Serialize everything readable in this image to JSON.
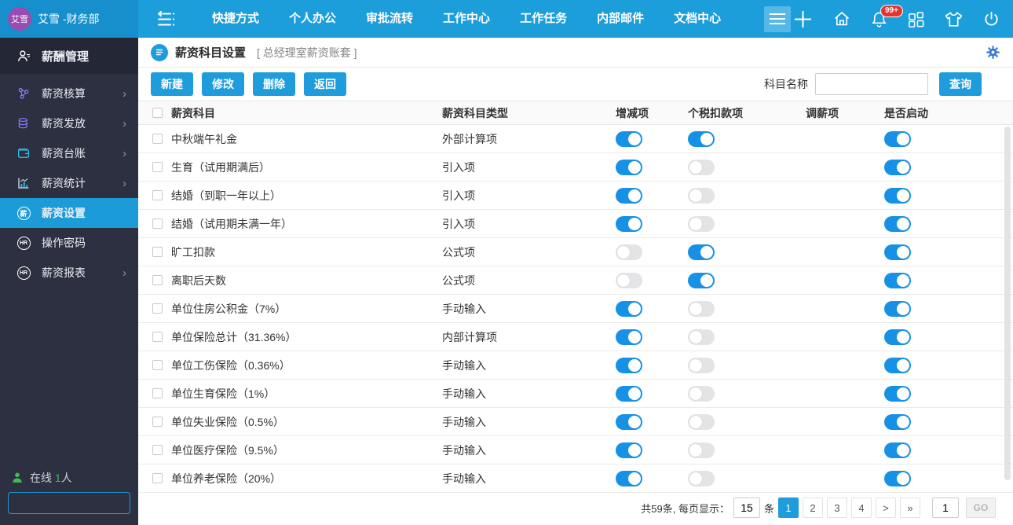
{
  "topbar": {
    "user": {
      "avatar_text": "艾雪",
      "name": "艾雪 -财务部"
    },
    "nav_items": [
      "快捷方式",
      "个人办公",
      "审批流转",
      "工作中心",
      "工作任务",
      "内部邮件",
      "文档中心"
    ],
    "notification_badge": "99+"
  },
  "sidebar": {
    "items": [
      {
        "label": "薪酬管理",
        "icon": "user-icon",
        "style": "header",
        "arrow": false,
        "active": false
      },
      {
        "label": "薪资核算",
        "icon": "nodes-icon",
        "style": "item",
        "arrow": true,
        "active": false
      },
      {
        "label": "薪资发放",
        "icon": "coins-icon",
        "style": "item",
        "arrow": true,
        "active": false
      },
      {
        "label": "薪资台账",
        "icon": "wallet-icon",
        "style": "item",
        "arrow": true,
        "active": false
      },
      {
        "label": "薪资统计",
        "icon": "chart-icon",
        "style": "item",
        "arrow": true,
        "active": false
      },
      {
        "label": "薪资设置",
        "icon": "salary-circle-icon",
        "style": "item",
        "arrow": false,
        "active": true
      },
      {
        "label": "操作密码",
        "icon": "hr-circle-icon",
        "style": "item",
        "arrow": false,
        "active": false
      },
      {
        "label": "薪资报表",
        "icon": "hr-circle-icon",
        "style": "item",
        "arrow": true,
        "active": false
      }
    ],
    "online": {
      "prefix": "在线",
      "count": "1",
      "suffix": "人"
    },
    "search_value": ""
  },
  "page": {
    "title": "薪资科目设置",
    "subtitle": "[ 总经理室薪资账套 ]",
    "toolbar": {
      "buttons": [
        {
          "label": "新建",
          "name": "new-button"
        },
        {
          "label": "修改",
          "name": "edit-button"
        },
        {
          "label": "删除",
          "name": "delete-button"
        },
        {
          "label": "返回",
          "name": "back-button"
        }
      ],
      "filter_label": "科目名称",
      "filter_value": "",
      "search_button": "查询"
    },
    "table": {
      "columns": [
        "薪资科目",
        "薪资科目类型",
        "增减项",
        "个税扣款项",
        "调薪项",
        "是否启动"
      ],
      "rows": [
        {
          "name": "中秋端午礼金",
          "type": "外部计算项",
          "inc": "on",
          "tax": "on",
          "adjust": "",
          "enabled": "on"
        },
        {
          "name": "生育（试用期满后）",
          "type": "引入项",
          "inc": "on",
          "tax": "off",
          "adjust": "",
          "enabled": "on"
        },
        {
          "name": "结婚（到职一年以上）",
          "type": "引入项",
          "inc": "on",
          "tax": "off",
          "adjust": "",
          "enabled": "on"
        },
        {
          "name": "结婚（试用期未满一年）",
          "type": "引入项",
          "inc": "on",
          "tax": "off",
          "adjust": "",
          "enabled": "on"
        },
        {
          "name": "旷工扣款",
          "type": "公式项",
          "inc": "off",
          "tax": "on",
          "adjust": "",
          "enabled": "on"
        },
        {
          "name": "离职后天数",
          "type": "公式项",
          "inc": "off",
          "tax": "on",
          "adjust": "",
          "enabled": "on"
        },
        {
          "name": "单位住房公积金（7%）",
          "type": "手动输入",
          "inc": "on",
          "tax": "off",
          "adjust": "",
          "enabled": "on"
        },
        {
          "name": "单位保险总计（31.36%）",
          "type": "内部计算项",
          "inc": "on",
          "tax": "off",
          "adjust": "",
          "enabled": "on"
        },
        {
          "name": "单位工伤保险（0.36%）",
          "type": "手动输入",
          "inc": "on",
          "tax": "off",
          "adjust": "",
          "enabled": "on"
        },
        {
          "name": "单位生育保险（1%）",
          "type": "手动输入",
          "inc": "on",
          "tax": "off",
          "adjust": "",
          "enabled": "on"
        },
        {
          "name": "单位失业保险（0.5%）",
          "type": "手动输入",
          "inc": "on",
          "tax": "off",
          "adjust": "",
          "enabled": "on"
        },
        {
          "name": "单位医疗保险（9.5%）",
          "type": "手动输入",
          "inc": "on",
          "tax": "off",
          "adjust": "",
          "enabled": "on"
        },
        {
          "name": "单位养老保险（20%）",
          "type": "手动输入",
          "inc": "on",
          "tax": "off",
          "adjust": "",
          "enabled": "on"
        }
      ]
    },
    "pagination": {
      "summary": "共59条, 每页显示：",
      "page_size": "15",
      "unit": "条",
      "pages": [
        "1",
        "2",
        "3",
        "4"
      ],
      "active_page": "1",
      "next": ">",
      "last": "»",
      "goto_value": "1",
      "go_label": "GO"
    }
  },
  "colors": {
    "topbar_blue": "#1c9edb",
    "accent_blue": "#1e9cdb",
    "sidebar_dark": "#2c3040",
    "toggle_on": "#1791e6",
    "badge_red": "#e5342f",
    "online_green": "#3dbb55",
    "avatar_purple": "#9a4cb0"
  }
}
